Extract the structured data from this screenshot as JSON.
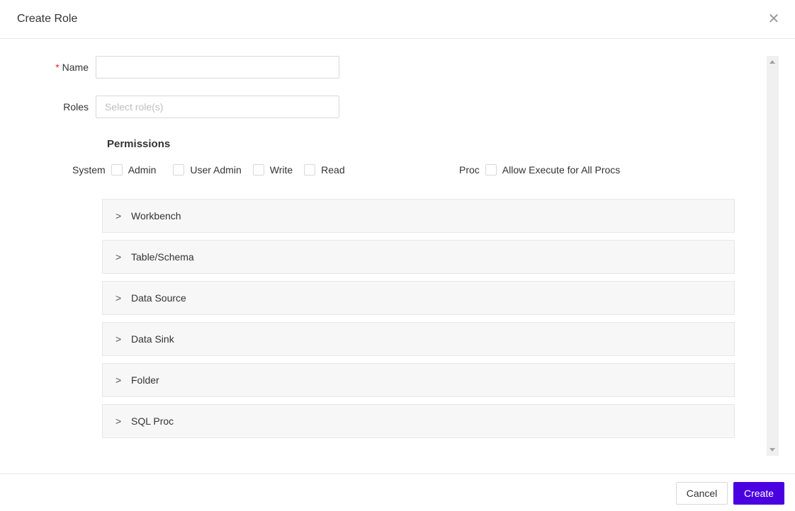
{
  "header": {
    "title": "Create Role",
    "close_icon": "close-icon"
  },
  "form": {
    "name": {
      "label": "Name",
      "required_mark": "*",
      "value": "",
      "placeholder": ""
    },
    "roles": {
      "label": "Roles",
      "value": "",
      "placeholder": "Select role(s)"
    }
  },
  "permissions": {
    "title": "Permissions",
    "system": {
      "label": "System",
      "options": [
        {
          "label": "Admin",
          "checked": false
        },
        {
          "label": "User Admin",
          "checked": false
        },
        {
          "label": "Write",
          "checked": false
        },
        {
          "label": "Read",
          "checked": false
        }
      ]
    },
    "proc": {
      "label": "Proc",
      "options": [
        {
          "label": "Allow Execute for All Procs",
          "checked": false
        }
      ]
    },
    "panels": [
      {
        "label": "Workbench",
        "expanded": false
      },
      {
        "label": "Table/Schema",
        "expanded": false
      },
      {
        "label": "Data Source",
        "expanded": false
      },
      {
        "label": "Data Sink",
        "expanded": false
      },
      {
        "label": "Folder",
        "expanded": false
      },
      {
        "label": "SQL Proc",
        "expanded": false
      }
    ],
    "chevron_glyph": ">"
  },
  "footer": {
    "cancel_label": "Cancel",
    "create_label": "Create"
  },
  "colors": {
    "primary": "#4a00e0",
    "required": "#f5222d",
    "panel_bg": "#f7f7f7"
  }
}
